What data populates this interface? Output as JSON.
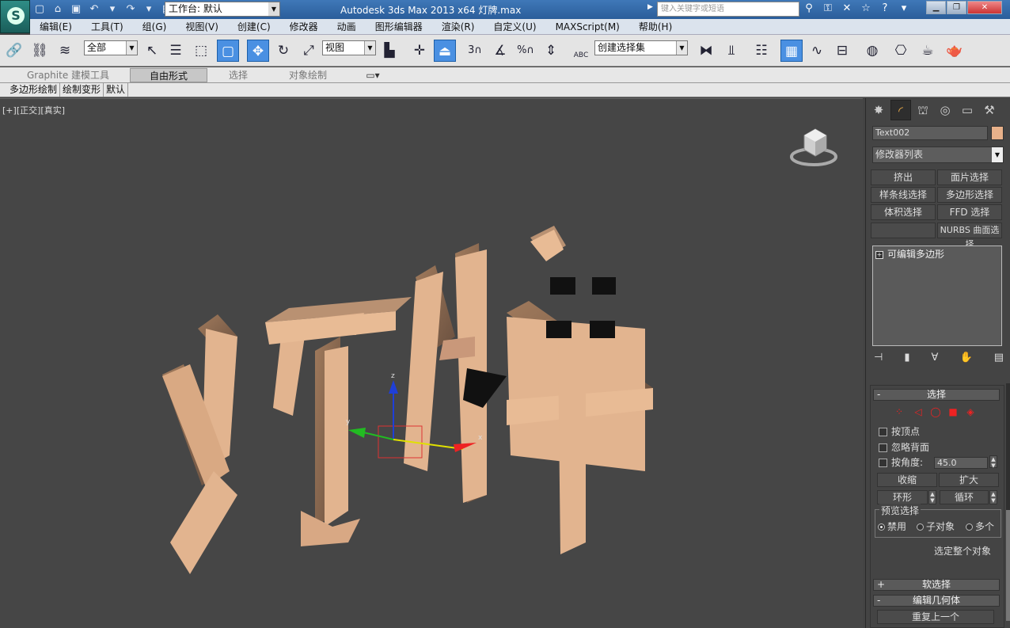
{
  "titlebar": {
    "workspace_label": "工作台: 默认",
    "title": "Autodesk 3ds Max  2013 x64       灯牌.max",
    "search_placeholder": "键入关键字或短语"
  },
  "menu": [
    "编辑(E)",
    "工具(T)",
    "组(G)",
    "视图(V)",
    "创建(C)",
    "修改器",
    "动画",
    "图形编辑器",
    "渲染(R)",
    "自定义(U)",
    "MAXScript(M)",
    "帮助(H)"
  ],
  "toolbar": {
    "selection_filter": "全部",
    "ref_coord": "视图",
    "named_selection": "创建选择集",
    "snap_3": "3",
    "snap_pct": "%",
    "abc": "ABC"
  },
  "ribbon": {
    "tabs": [
      "Graphite 建模工具",
      "自由形式",
      "选择",
      "对象绘制"
    ],
    "active_tab": "自由形式",
    "subtabs": [
      "多边形绘制",
      "绘制变形",
      "默认"
    ]
  },
  "viewport": {
    "label_plus": "[+]",
    "label_view": "[正交]",
    "label_shade": "[真实]",
    "scene_text": "灯牌",
    "gizmo_x": "x",
    "gizmo_y": "y",
    "gizmo_z": "z"
  },
  "command_panel": {
    "object_name": "Text002",
    "object_color": "#e8b18a",
    "modifier_list": "修改器列表",
    "buttons": [
      "挤出",
      "面片选择",
      "样条线选择",
      "多边形选择",
      "体积选择",
      "FFD 选择",
      "",
      "NURBS 曲面选择"
    ],
    "stack_item": "可编辑多边形",
    "rollout_select": {
      "title": "选择",
      "by_vertex": "按顶点",
      "ignore_backfacing": "忽略背面",
      "by_angle": "按角度:",
      "angle_value": "45.0",
      "shrink": "收缩",
      "grow": "扩大",
      "ring": "环形",
      "loop": "循环",
      "preview_title": "预览选择",
      "preview_off": "禁用",
      "preview_subobj": "子对象",
      "preview_multi": "多个",
      "select_whole": "选定整个对象"
    },
    "rollout_soft": "软选择",
    "rollout_geom": "编辑几何体",
    "repeat_last": "重复上一个"
  },
  "colors": {
    "titlebar": "#2f68a8",
    "viewport_bg": "#464646",
    "text_front": "#e2b48f",
    "active_button": "#4a90e2"
  }
}
